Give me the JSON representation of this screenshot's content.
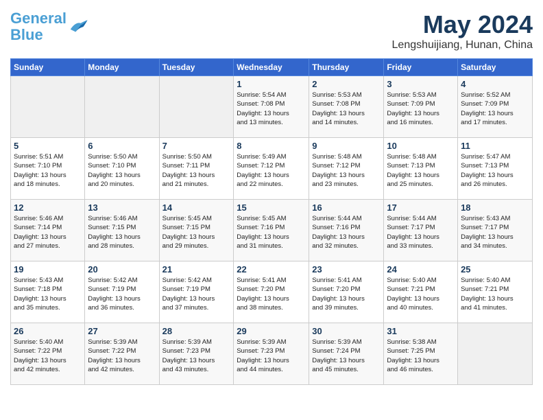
{
  "header": {
    "logo_line1": "General",
    "logo_line2": "Blue",
    "month_year": "May 2024",
    "location": "Lengshuijiang, Hunan, China"
  },
  "days_of_week": [
    "Sunday",
    "Monday",
    "Tuesday",
    "Wednesday",
    "Thursday",
    "Friday",
    "Saturday"
  ],
  "weeks": [
    [
      {
        "num": "",
        "info": ""
      },
      {
        "num": "",
        "info": ""
      },
      {
        "num": "",
        "info": ""
      },
      {
        "num": "1",
        "info": "Sunrise: 5:54 AM\nSunset: 7:08 PM\nDaylight: 13 hours\nand 13 minutes."
      },
      {
        "num": "2",
        "info": "Sunrise: 5:53 AM\nSunset: 7:08 PM\nDaylight: 13 hours\nand 14 minutes."
      },
      {
        "num": "3",
        "info": "Sunrise: 5:53 AM\nSunset: 7:09 PM\nDaylight: 13 hours\nand 16 minutes."
      },
      {
        "num": "4",
        "info": "Sunrise: 5:52 AM\nSunset: 7:09 PM\nDaylight: 13 hours\nand 17 minutes."
      }
    ],
    [
      {
        "num": "5",
        "info": "Sunrise: 5:51 AM\nSunset: 7:10 PM\nDaylight: 13 hours\nand 18 minutes."
      },
      {
        "num": "6",
        "info": "Sunrise: 5:50 AM\nSunset: 7:10 PM\nDaylight: 13 hours\nand 20 minutes."
      },
      {
        "num": "7",
        "info": "Sunrise: 5:50 AM\nSunset: 7:11 PM\nDaylight: 13 hours\nand 21 minutes."
      },
      {
        "num": "8",
        "info": "Sunrise: 5:49 AM\nSunset: 7:12 PM\nDaylight: 13 hours\nand 22 minutes."
      },
      {
        "num": "9",
        "info": "Sunrise: 5:48 AM\nSunset: 7:12 PM\nDaylight: 13 hours\nand 23 minutes."
      },
      {
        "num": "10",
        "info": "Sunrise: 5:48 AM\nSunset: 7:13 PM\nDaylight: 13 hours\nand 25 minutes."
      },
      {
        "num": "11",
        "info": "Sunrise: 5:47 AM\nSunset: 7:13 PM\nDaylight: 13 hours\nand 26 minutes."
      }
    ],
    [
      {
        "num": "12",
        "info": "Sunrise: 5:46 AM\nSunset: 7:14 PM\nDaylight: 13 hours\nand 27 minutes."
      },
      {
        "num": "13",
        "info": "Sunrise: 5:46 AM\nSunset: 7:15 PM\nDaylight: 13 hours\nand 28 minutes."
      },
      {
        "num": "14",
        "info": "Sunrise: 5:45 AM\nSunset: 7:15 PM\nDaylight: 13 hours\nand 29 minutes."
      },
      {
        "num": "15",
        "info": "Sunrise: 5:45 AM\nSunset: 7:16 PM\nDaylight: 13 hours\nand 31 minutes."
      },
      {
        "num": "16",
        "info": "Sunrise: 5:44 AM\nSunset: 7:16 PM\nDaylight: 13 hours\nand 32 minutes."
      },
      {
        "num": "17",
        "info": "Sunrise: 5:44 AM\nSunset: 7:17 PM\nDaylight: 13 hours\nand 33 minutes."
      },
      {
        "num": "18",
        "info": "Sunrise: 5:43 AM\nSunset: 7:17 PM\nDaylight: 13 hours\nand 34 minutes."
      }
    ],
    [
      {
        "num": "19",
        "info": "Sunrise: 5:43 AM\nSunset: 7:18 PM\nDaylight: 13 hours\nand 35 minutes."
      },
      {
        "num": "20",
        "info": "Sunrise: 5:42 AM\nSunset: 7:19 PM\nDaylight: 13 hours\nand 36 minutes."
      },
      {
        "num": "21",
        "info": "Sunrise: 5:42 AM\nSunset: 7:19 PM\nDaylight: 13 hours\nand 37 minutes."
      },
      {
        "num": "22",
        "info": "Sunrise: 5:41 AM\nSunset: 7:20 PM\nDaylight: 13 hours\nand 38 minutes."
      },
      {
        "num": "23",
        "info": "Sunrise: 5:41 AM\nSunset: 7:20 PM\nDaylight: 13 hours\nand 39 minutes."
      },
      {
        "num": "24",
        "info": "Sunrise: 5:40 AM\nSunset: 7:21 PM\nDaylight: 13 hours\nand 40 minutes."
      },
      {
        "num": "25",
        "info": "Sunrise: 5:40 AM\nSunset: 7:21 PM\nDaylight: 13 hours\nand 41 minutes."
      }
    ],
    [
      {
        "num": "26",
        "info": "Sunrise: 5:40 AM\nSunset: 7:22 PM\nDaylight: 13 hours\nand 42 minutes."
      },
      {
        "num": "27",
        "info": "Sunrise: 5:39 AM\nSunset: 7:22 PM\nDaylight: 13 hours\nand 42 minutes."
      },
      {
        "num": "28",
        "info": "Sunrise: 5:39 AM\nSunset: 7:23 PM\nDaylight: 13 hours\nand 43 minutes."
      },
      {
        "num": "29",
        "info": "Sunrise: 5:39 AM\nSunset: 7:23 PM\nDaylight: 13 hours\nand 44 minutes."
      },
      {
        "num": "30",
        "info": "Sunrise: 5:39 AM\nSunset: 7:24 PM\nDaylight: 13 hours\nand 45 minutes."
      },
      {
        "num": "31",
        "info": "Sunrise: 5:38 AM\nSunset: 7:25 PM\nDaylight: 13 hours\nand 46 minutes."
      },
      {
        "num": "",
        "info": ""
      }
    ]
  ]
}
